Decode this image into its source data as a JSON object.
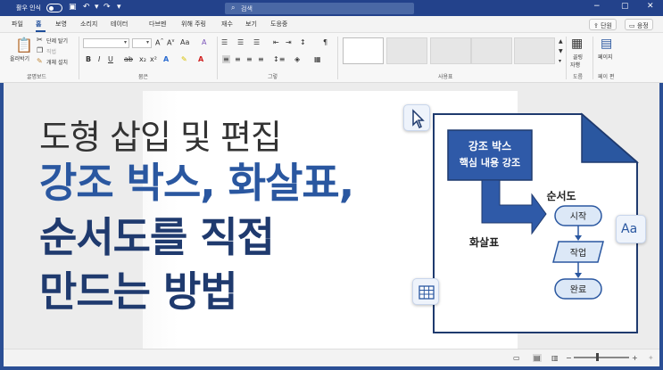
{
  "titlebar": {
    "autosave_label": "활우 인식",
    "search_placeholder": "검색"
  },
  "menu": {
    "tabs": [
      "파일",
      "홈",
      "보영",
      "소리지",
      "테이터",
      "다브멘",
      "위해 주링",
      "재수",
      "보기",
      "도응중"
    ],
    "active_tab": "홈",
    "share_label": "단원",
    "comment_label": "응정"
  },
  "ribbon": {
    "paste_label": "올러박기",
    "cut_label": "단제 탈기",
    "copy_label": "직법",
    "format_label": "개체 설치",
    "clipboard_group": "굴명보드",
    "font_group": "뭄은",
    "paragraph_group": "그렇",
    "styles_group": "사용표",
    "find_group": "도름",
    "pages_label": "페이지",
    "pages_group": "페이 편",
    "apply_label": "골링",
    "apply_sub": "자행"
  },
  "document": {
    "heading_line1": "도형 삽입 및 편집",
    "heading_line2": "강조 박스, 화살표,",
    "heading_line3": "순서도를 직접",
    "heading_line4": "만드는 방법",
    "callout_line1": "강조 박스",
    "callout_line2": "핵심 내용 강조",
    "arrow_label": "화살표",
    "flow_title": "순서도",
    "flow_start": "시작",
    "flow_step": "작업",
    "flow_end": "완료",
    "font_card_label": "Aa"
  },
  "colors": {
    "title_bar": "#23428b",
    "accent_blue": "#2a57a0",
    "dark_navy": "#1f3a6e",
    "callout_fill": "#2f5aa8",
    "flow_fill": "#dce8f7"
  },
  "icons": [
    "cursor-icon",
    "table-icon",
    "font-icon",
    "paste-icon",
    "scissors-icon",
    "copy-icon",
    "brush-icon",
    "save-icon",
    "undo-icon",
    "redo-icon",
    "search-icon"
  ]
}
